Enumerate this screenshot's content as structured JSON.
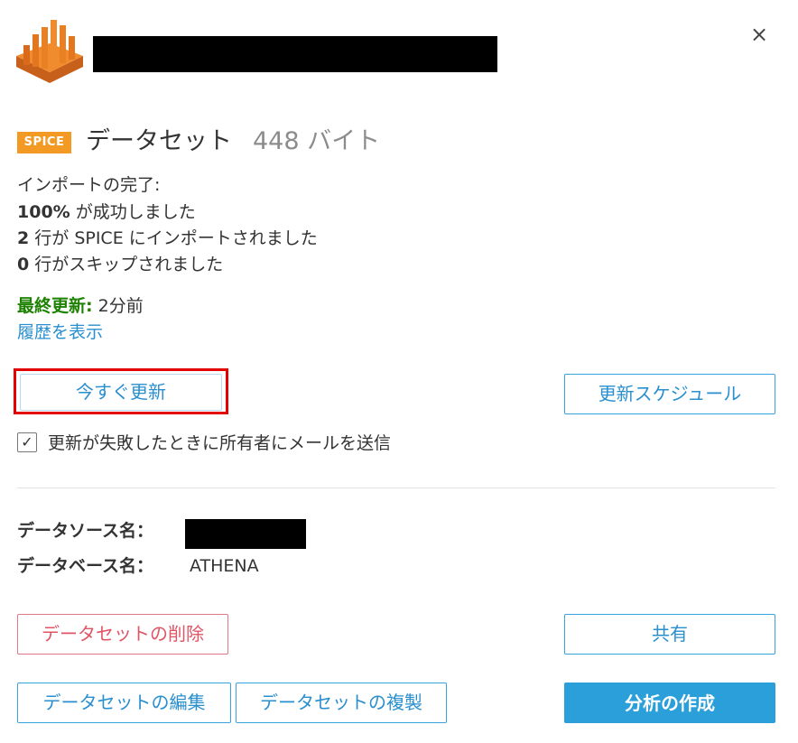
{
  "header": {
    "close_icon": "×"
  },
  "dataset": {
    "badge": "SPICE",
    "label": "データセット",
    "size": "448 バイト"
  },
  "import": {
    "title": "インポートの完了:",
    "success_value": "100%",
    "success_text": " が成功しました",
    "rows_value": "2",
    "rows_text": " 行が SPICE にインポートされました",
    "skipped_value": "0",
    "skipped_text": " 行がスキップされました"
  },
  "refresh": {
    "last_updated_label": "最終更新:",
    "last_updated_value": " 2分前",
    "history_link": "履歴を表示",
    "refresh_now": "今すぐ更新",
    "schedule": "更新スケジュール",
    "notify_checked": true,
    "notify_label": "更新が失敗したときに所有者にメールを送信"
  },
  "source": {
    "datasource_label": "データソース名：",
    "database_label": "データベース名：",
    "database_value": "ATHENA"
  },
  "actions": {
    "delete": "データセットの削除",
    "share": "共有",
    "edit": "データセットの編集",
    "duplicate": "データセットの複製",
    "create_analysis": "分析の作成"
  },
  "colors": {
    "accent": "#2a9fd9",
    "badge": "#f29a23",
    "danger": "#e05566",
    "success": "#1d8102",
    "highlight": "#e30000"
  },
  "icons": {
    "logo": "quicksight-logo-icon",
    "close": "close-icon",
    "check": "checkmark-icon"
  }
}
